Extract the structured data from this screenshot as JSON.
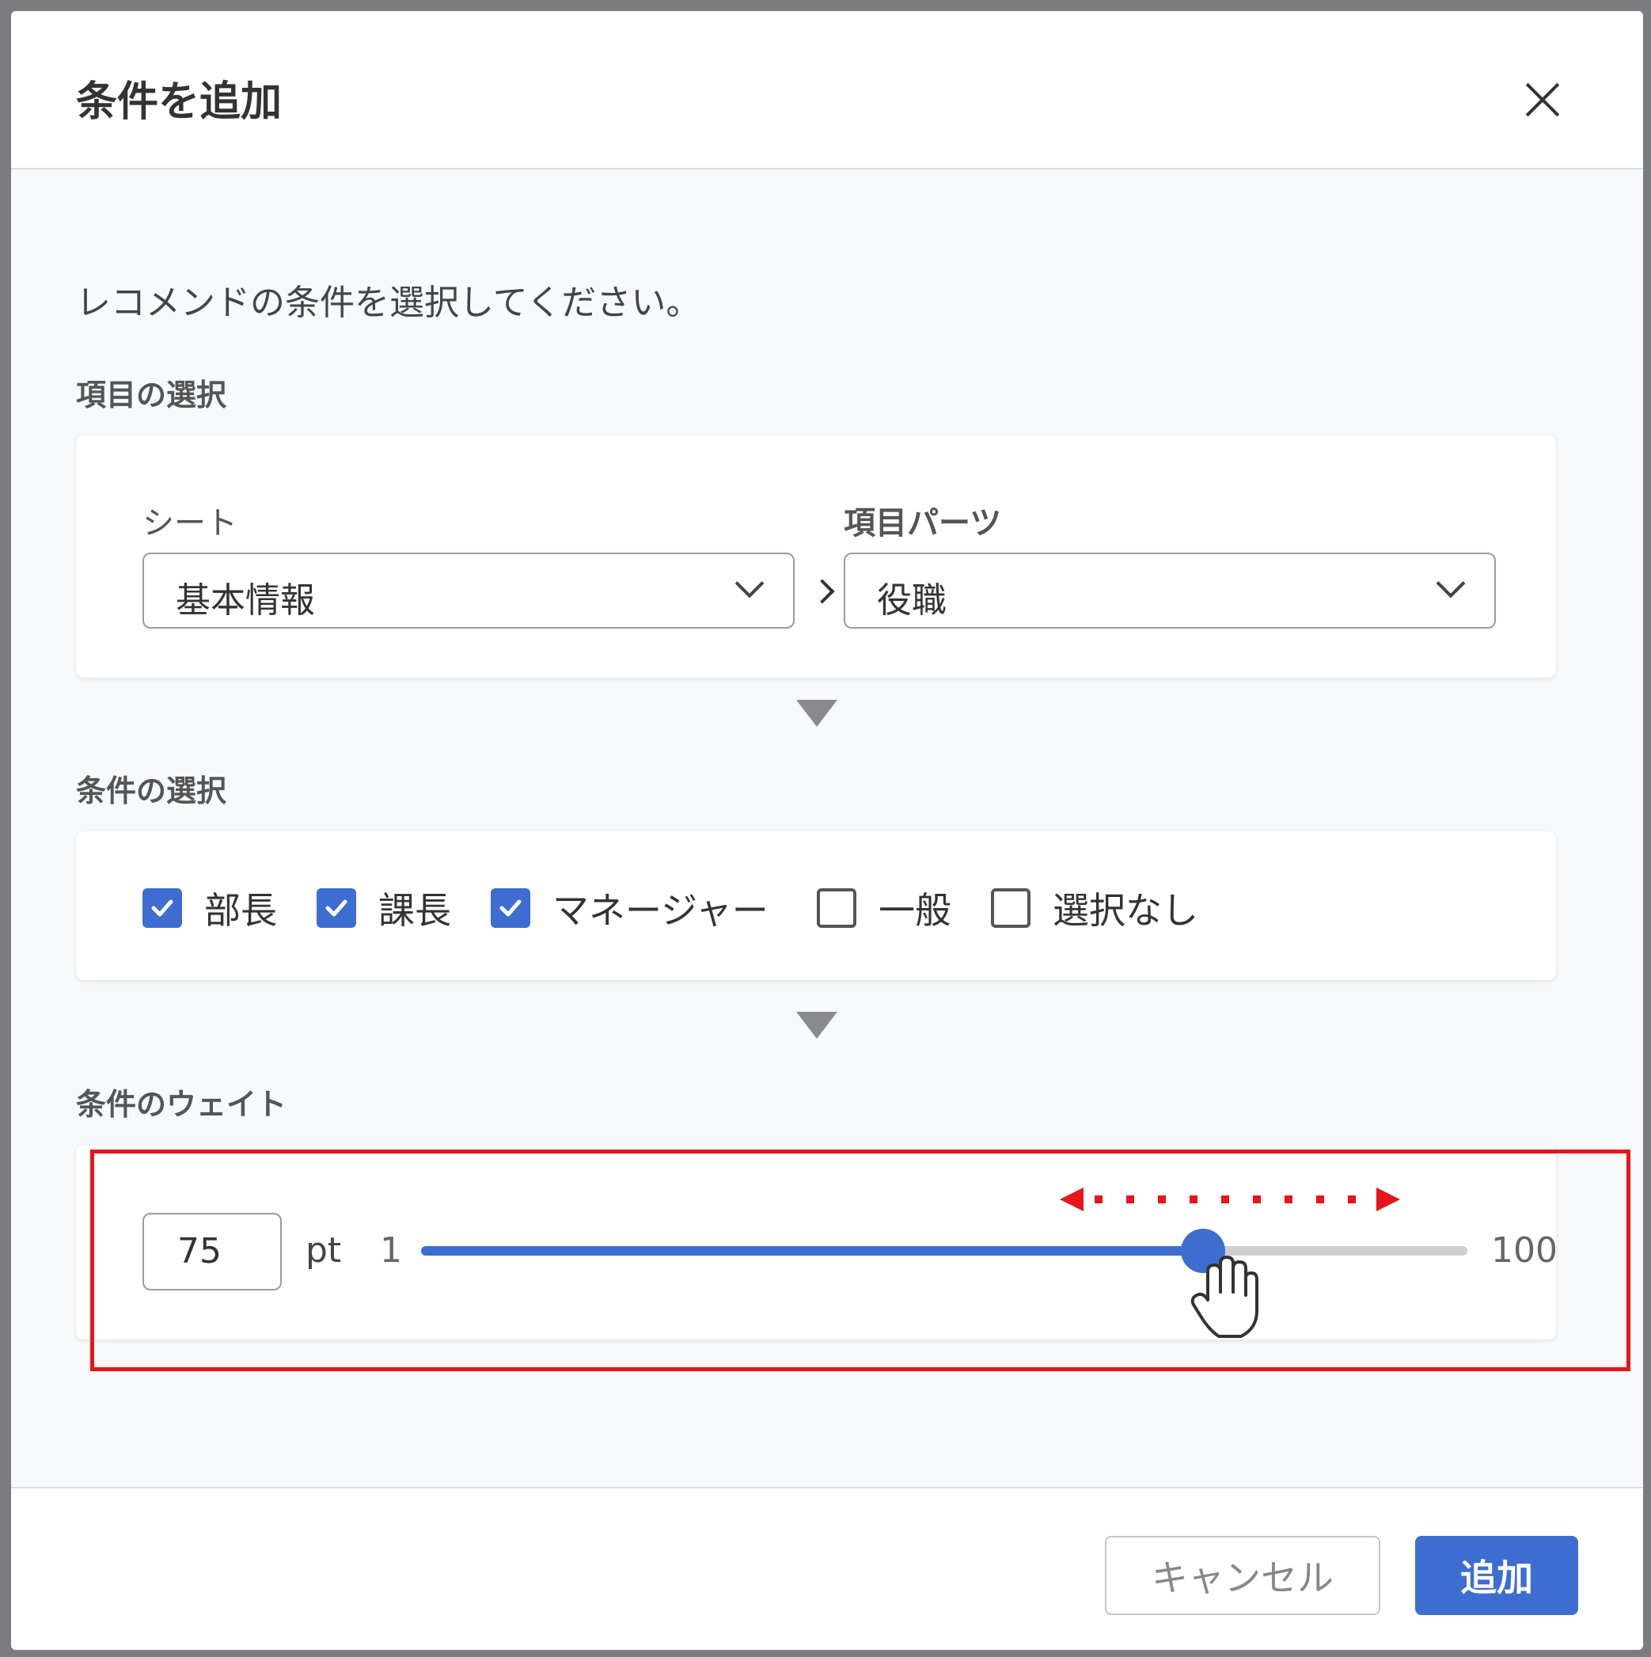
{
  "dialog": {
    "title": "条件を追加",
    "description": "レコメンドの条件を選択してください。"
  },
  "item_selection": {
    "section_label": "項目の選択",
    "sheet_label": "シート",
    "sheet_value": "基本情報",
    "part_label": "項目パーツ",
    "part_value": "役職"
  },
  "condition_selection": {
    "section_label": "条件の選択",
    "options": [
      {
        "label": "部長",
        "checked": true
      },
      {
        "label": "課長",
        "checked": true
      },
      {
        "label": "マネージャー",
        "checked": true
      },
      {
        "label": "一般",
        "checked": false
      },
      {
        "label": "選択なし",
        "checked": false
      }
    ]
  },
  "weight": {
    "section_label": "条件のウェイト",
    "value": "75",
    "unit": "pt",
    "min": "1",
    "max": "100"
  },
  "footer": {
    "cancel_label": "キャンセル",
    "add_label": "追加"
  },
  "colors": {
    "accent": "#3e6dd2",
    "highlight": "#e8141b"
  }
}
